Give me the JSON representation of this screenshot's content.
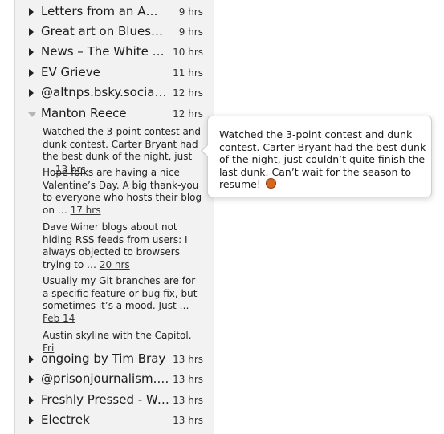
{
  "sidebar": {
    "feeds_top": [
      {
        "title": "Letters from an Am…",
        "age": "9 hrs"
      },
      {
        "title": "Great art on Bluesky…",
        "age": "9 hrs"
      },
      {
        "title": "News – The White H…",
        "age": "10 hrs"
      },
      {
        "title": "EV Grieve",
        "age": "11 hrs"
      },
      {
        "title": "@altnps.bsky.social …",
        "age": "12 hrs"
      }
    ],
    "expanded_feed": {
      "title": "Manton Reece",
      "age": "12 hrs",
      "posts": [
        {
          "text": "Watched the 3-point contest and dunk contest. Carter Bryant had the best dunk of the night, just …",
          "time": "13 hrs"
        },
        {
          "text": "Hope folks are having a nice Valentine’s Day. A big thank-you to everyone who hosts their blog on …",
          "time": "17 hrs"
        },
        {
          "text": "Dave Winer blogs about not hiding RSS feeds from users: I always objected to browsers trying to …",
          "time": "20 hrs"
        },
        {
          "text": "Usually my Git branches are for a specific feature or bug fix, but sometimes it’s a mood. Just …",
          "time": "Feb 14"
        },
        {
          "text": "Austin skyline with the Capitol.",
          "time": "Fri"
        }
      ]
    },
    "feeds_bottom": [
      {
        "title": "ongoing by Tim Bray",
        "age": "13 hrs"
      },
      {
        "title": "@prisonjournalism.…",
        "age": "13 hrs"
      },
      {
        "title": "Freshly Pressed - Wo…",
        "age": "13 hrs"
      },
      {
        "title": "Electrek",
        "age": "13 hrs"
      }
    ]
  },
  "tooltip": {
    "text": "Watched the 3-point contest and dunk contest. Carter Bryant had the best dunk of the night, just couldn’t quite finish the last dunk. Can’t wait for the season to resume!",
    "emoji_icon": "basketball-icon"
  }
}
